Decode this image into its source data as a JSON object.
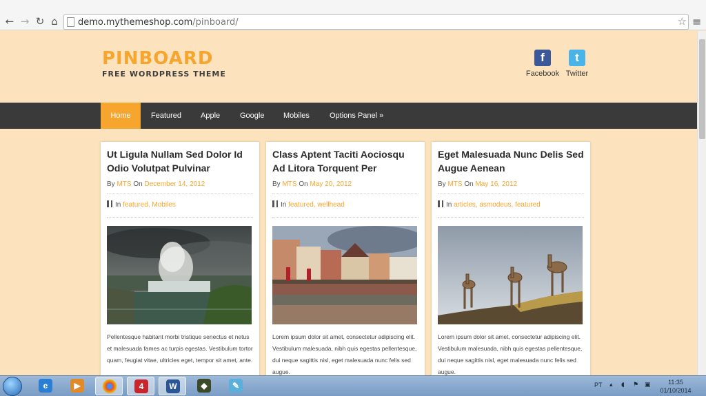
{
  "browser": {
    "url_host": "demo.mythemeshop.com",
    "url_path": "/pinboard/",
    "back_icon": "back-arrow-icon",
    "forward_icon": "forward-arrow-icon",
    "reload_icon": "reload-icon",
    "home_icon": "home-icon",
    "bookmark_icon": "star-icon",
    "menu_icon": "menu-icon"
  },
  "site": {
    "title": "PINBOARD",
    "tagline": "FREE WORDPRESS THEME",
    "accent_color": "#f6a52e",
    "background_color": "#fce3bd",
    "nav_color": "#3a3a3a"
  },
  "social": [
    {
      "label": "Facebook",
      "icon": "facebook-icon",
      "glyph": "f",
      "color": "#3b5998"
    },
    {
      "label": "Twitter",
      "icon": "twitter-icon",
      "glyph": "t",
      "color": "#4ab3e8"
    }
  ],
  "nav": [
    {
      "label": "Home",
      "active": true
    },
    {
      "label": "Featured"
    },
    {
      "label": "Apple"
    },
    {
      "label": "Google"
    },
    {
      "label": "Mobiles"
    },
    {
      "label": "Options Panel »"
    }
  ],
  "posts": [
    {
      "title": "Ut Ligula Nullam Sed Dolor Id Odio Volutpat Pulvinar",
      "by": "By",
      "author": "MTS",
      "on": "On",
      "date": "December 14, 2012",
      "in": "In",
      "categories": "featured, Mobiles",
      "image": "waterfall",
      "excerpt": "Pellentesque habitant morbi tristique senectus et netus et malesuada fames ac turpis egestas. Vestibulum tortor quam, feugiat vitae, ultricies eget, tempor sit amet, ante."
    },
    {
      "title": "Class Aptent Taciti Aociosqu Ad Litora Torquent Per",
      "by": "By",
      "author": "MTS",
      "on": "On",
      "date": "May 20, 2012",
      "in": "In",
      "categories": "featured, wellhead",
      "image": "canal-town",
      "excerpt": "Lorem ipsum dolor sit amet, consectetur adipiscing elit. Vestibulum malesuada, nibh quis egestas pellentesque, dui neque sagittis nisl, eget malesuada nunc felis sed augue."
    },
    {
      "title": "Eget Malesuada Nunc Delis Sed Augue Aenean",
      "by": "By",
      "author": "MTS",
      "on": "On",
      "date": "May 16, 2012",
      "in": "In",
      "categories": "articles, asmodeus, featured",
      "image": "deer",
      "excerpt": "Lorem ipsum dolor sit amet, consectetur adipiscing elit. Vestibulum malesuada, nibh quis egestas pellentesque, dui neque sagittis nisl, eget malesuada nunc felis sed augue."
    }
  ],
  "taskbar": {
    "apps": [
      "windows-start-icon",
      "internet-explorer-icon",
      "media-player-icon",
      "chrome-icon",
      "pdf-icon",
      "word-icon",
      "game-icon",
      "notepad-icon"
    ],
    "language": "PT",
    "time": "11:35",
    "date": "01/10/2014"
  }
}
